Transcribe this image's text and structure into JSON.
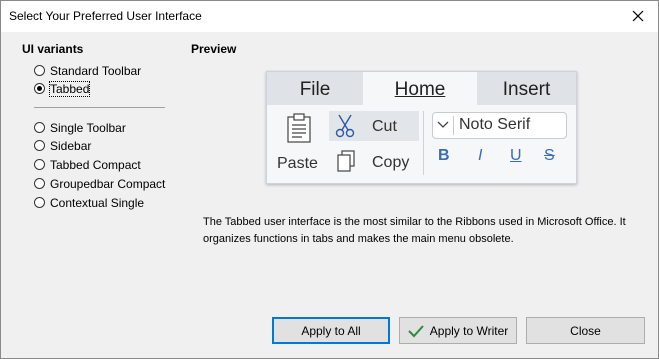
{
  "window": {
    "title": "Select Your Preferred User Interface"
  },
  "variants": {
    "label": "UI variants",
    "items": [
      {
        "label": "Standard Toolbar",
        "checked": false
      },
      {
        "label": "Tabbed",
        "checked": true
      },
      {
        "label": "Single Toolbar",
        "checked": false
      },
      {
        "label": "Sidebar",
        "checked": false
      },
      {
        "label": "Tabbed Compact",
        "checked": false
      },
      {
        "label": "Groupedbar Compact",
        "checked": false
      },
      {
        "label": "Contextual Single",
        "checked": false
      }
    ]
  },
  "preview": {
    "label": "Preview",
    "tabs": [
      "File",
      "Home",
      "Insert"
    ],
    "paste": "Paste",
    "cut": "Cut",
    "copy": "Copy",
    "font": "Noto Serif",
    "format": {
      "bold": "B",
      "italic": "I",
      "underline": "U",
      "strike": "S"
    }
  },
  "description": "The Tabbed user interface is the most similar to the Ribbons used in Microsoft Office. It organizes functions in tabs and makes the main menu obsolete.",
  "buttons": {
    "apply_all": "Apply to All",
    "apply_writer": "Apply to Writer",
    "close": "Close"
  },
  "icons": {
    "close": "close-icon",
    "paste": "clipboard-icon",
    "cut": "scissors-icon",
    "copy": "copy-icon",
    "chevron": "chevron-down-icon",
    "check": "checkmark-icon"
  },
  "colors": {
    "accent": "#0078d7",
    "format_icons": "#3a6bb5",
    "check": "#2e8b3a"
  }
}
